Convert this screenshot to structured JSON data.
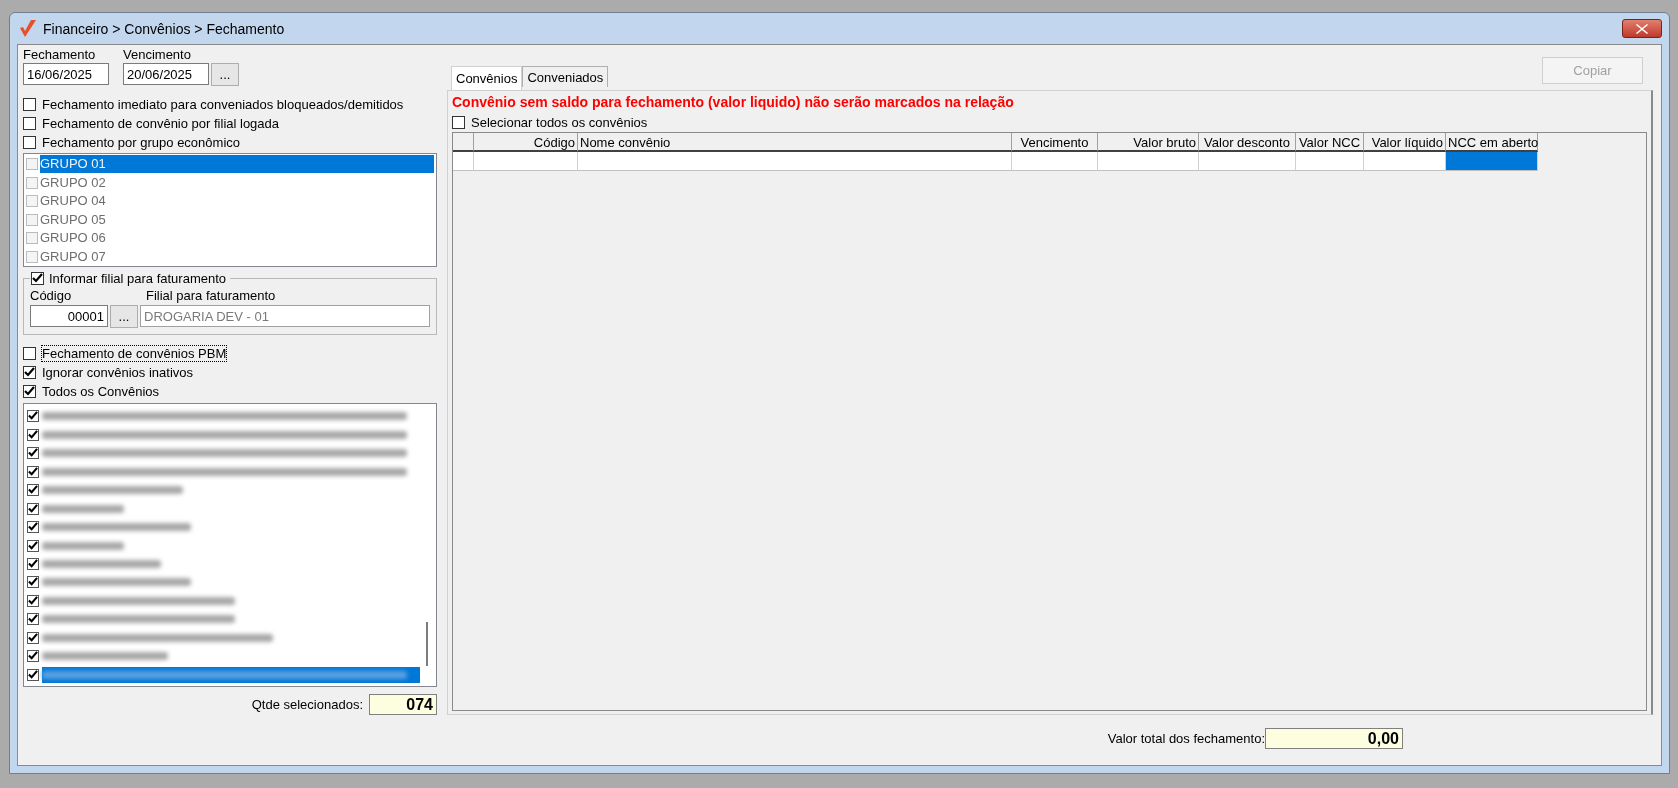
{
  "window": {
    "title": "Financeiro > Convênios > Fechamento"
  },
  "dates": [
    {
      "label": "Fechamento",
      "value": "16/06/2025"
    },
    {
      "label": "Vencimento",
      "value": "20/06/2025",
      "picker_label": "..."
    }
  ],
  "options_top": [
    {
      "label": "Fechamento imediato para conveniados bloqueados/demitidos",
      "checked": false
    },
    {
      "label": "Fechamento de convênio por filial logada",
      "checked": false
    },
    {
      "label": "Fechamento por grupo econômico",
      "checked": false
    }
  ],
  "groups": {
    "disabled": true,
    "items": [
      {
        "label": "GRUPO 01",
        "checked": false,
        "selected": true
      },
      {
        "label": "GRUPO 02",
        "checked": false,
        "selected": false
      },
      {
        "label": "GRUPO 04",
        "checked": false,
        "selected": false
      },
      {
        "label": "GRUPO 05",
        "checked": false,
        "selected": false
      },
      {
        "label": "GRUPO 06",
        "checked": false,
        "selected": false
      },
      {
        "label": "GRUPO 07",
        "checked": false,
        "selected": false
      }
    ]
  },
  "billing_branch": {
    "label": "Informar filial para faturamento",
    "checked": true,
    "code_label": "Código",
    "code_value": "00001",
    "picker_label": "...",
    "branch_label": "Filial para faturamento",
    "branch_value": "DROGARIA DEV - 01"
  },
  "options_bottom": [
    {
      "label": "Fechamento de convênios PBM",
      "checked": false,
      "focused": true
    },
    {
      "label": "Ignorar convênios inativos",
      "checked": true,
      "focused": false
    },
    {
      "label": "Todos os Convênios",
      "checked": true,
      "focused": false
    }
  ],
  "convenios": [
    {
      "checked": true,
      "selected": false
    },
    {
      "checked": true,
      "selected": false
    },
    {
      "checked": true,
      "selected": false
    },
    {
      "checked": true,
      "selected": false
    },
    {
      "checked": true,
      "selected": false
    },
    {
      "checked": true,
      "selected": false
    },
    {
      "checked": true,
      "selected": false
    },
    {
      "checked": true,
      "selected": false
    },
    {
      "checked": true,
      "selected": false
    },
    {
      "checked": true,
      "selected": false
    },
    {
      "checked": true,
      "selected": false
    },
    {
      "checked": true,
      "selected": false
    },
    {
      "checked": true,
      "selected": false
    },
    {
      "checked": true,
      "selected": false
    },
    {
      "checked": true,
      "selected": true
    }
  ],
  "selected_count": {
    "label": "Qtde selecionados:",
    "value": "074"
  },
  "tabs": [
    {
      "label": "Convênios",
      "selected": true
    },
    {
      "label": "Conveniados",
      "selected": false
    }
  ],
  "copy_button": {
    "label": "Copiar",
    "disabled": true
  },
  "warning": "Convênio sem saldo para fechamento (valor liquido) não serão marcados na relação",
  "select_all": {
    "label": "Selecionar todos os convênios",
    "checked": false
  },
  "table": {
    "columns": [
      {
        "label": "Código",
        "selected": false
      },
      {
        "label": "Nome convênio",
        "selected": false
      },
      {
        "label": "Vencimento",
        "selected": false
      },
      {
        "label": "Valor bruto",
        "selected": false
      },
      {
        "label": "Valor desconto",
        "selected": false
      },
      {
        "label": "Valor NCC",
        "selected": false
      },
      {
        "label": "Valor líquido",
        "selected": false
      },
      {
        "label": "NCC em aberto",
        "selected": true
      }
    ]
  },
  "total": {
    "label": "Valor total dos fechamento:",
    "value": "0,00"
  }
}
